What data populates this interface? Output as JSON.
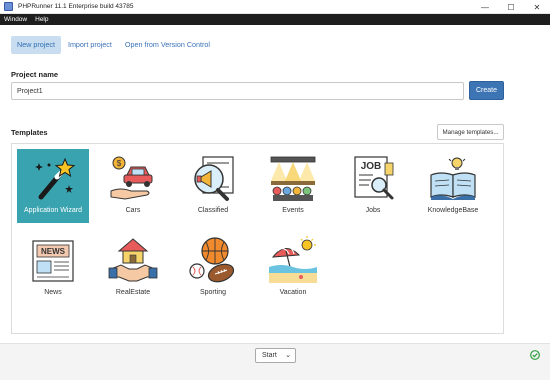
{
  "window": {
    "title": "PHPRunner 11.1 Enterprise build 43785",
    "minimize_glyph": "—",
    "maximize_glyph": "☐",
    "close_glyph": "✕"
  },
  "menu": [
    "Window",
    "Help"
  ],
  "tabs": [
    {
      "label": "New project",
      "active": true
    },
    {
      "label": "Import project",
      "active": false
    },
    {
      "label": "Open from Version Control",
      "active": false
    }
  ],
  "project": {
    "label": "Project name",
    "value": "Project1",
    "create_label": "Create"
  },
  "templates": {
    "label": "Templates",
    "manage_label": "Manage templates...",
    "items": [
      {
        "name": "Application Wizard",
        "icon": "magic-wand-icon",
        "selected": true
      },
      {
        "name": "Cars",
        "icon": "car-icon",
        "selected": false
      },
      {
        "name": "Classified",
        "icon": "megaphone-icon",
        "selected": false
      },
      {
        "name": "Events",
        "icon": "stage-icon",
        "selected": false
      },
      {
        "name": "Jobs",
        "icon": "job-search-icon",
        "selected": false
      },
      {
        "name": "KnowledgeBase",
        "icon": "open-book-icon",
        "selected": false
      },
      {
        "name": "News",
        "icon": "newspaper-icon",
        "selected": false
      },
      {
        "name": "RealEstate",
        "icon": "house-handshake-icon",
        "selected": false
      },
      {
        "name": "Sporting",
        "icon": "balls-icon",
        "selected": false
      },
      {
        "name": "Vacation",
        "icon": "beach-icon",
        "selected": false
      }
    ]
  },
  "footer": {
    "start_value": "Start",
    "status_icon": "check-circle-icon"
  },
  "colors": {
    "accent": "#3d74b3",
    "selected_tile": "#3aa3b0",
    "status_ok": "#2e9e3e"
  }
}
